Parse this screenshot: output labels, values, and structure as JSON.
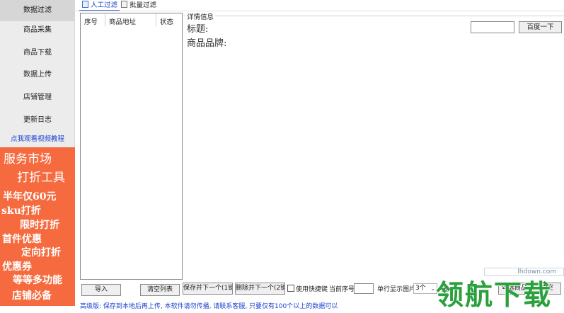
{
  "sidebar": {
    "items": [
      {
        "label": "数据过滤"
      },
      {
        "label": "商品采集"
      },
      {
        "label": "商品下载"
      },
      {
        "label": "数据上传"
      },
      {
        "label": "店铺管理"
      },
      {
        "label": "更新日志"
      }
    ],
    "tutorial_link": "点我观看视频教程"
  },
  "promo": {
    "lines": [
      "服务市场",
      "打折工具",
      "半年仅60元",
      "sku打折",
      "限时打折",
      "首件优惠",
      "定向打折",
      "优惠券",
      "等等多功能",
      "店铺必备"
    ]
  },
  "tabs": [
    {
      "label": "人工过滤"
    },
    {
      "label": "批量过滤"
    }
  ],
  "list": {
    "columns": [
      "序号",
      "商品地址",
      "状态"
    ]
  },
  "detail": {
    "legend": "详情信息",
    "title_label": "标题:",
    "brand_label": "商品品牌:",
    "search_value": "",
    "baidu_button": "百度一下"
  },
  "bottom": {
    "import_button": "导入",
    "clear_button": "清空列表",
    "keep_next_button": "保存并下一个(1键)",
    "drop_next_button": "删除并下一个(2键)",
    "shortcut_label": "使用快捷键",
    "current_seq_label": "当前序号",
    "current_seq_value": "",
    "per_row_label": "单行显示图片",
    "per_row_value": "3个",
    "extra_label": "按",
    "select_all_button": "勾选商品",
    "clear_button2": "清空",
    "status_text": "高级版: 保存到本地后再上传, 本软件请勿传播, 请联系客服, 只要仅有100个以上的数据可以"
  },
  "watermark": {
    "site": "lhdown.com",
    "text": "领航下载"
  },
  "colors": {
    "promo_bg": "#f56a3e",
    "link_blue": "#1a3fd0",
    "watermark_green": "#2aa13c"
  }
}
